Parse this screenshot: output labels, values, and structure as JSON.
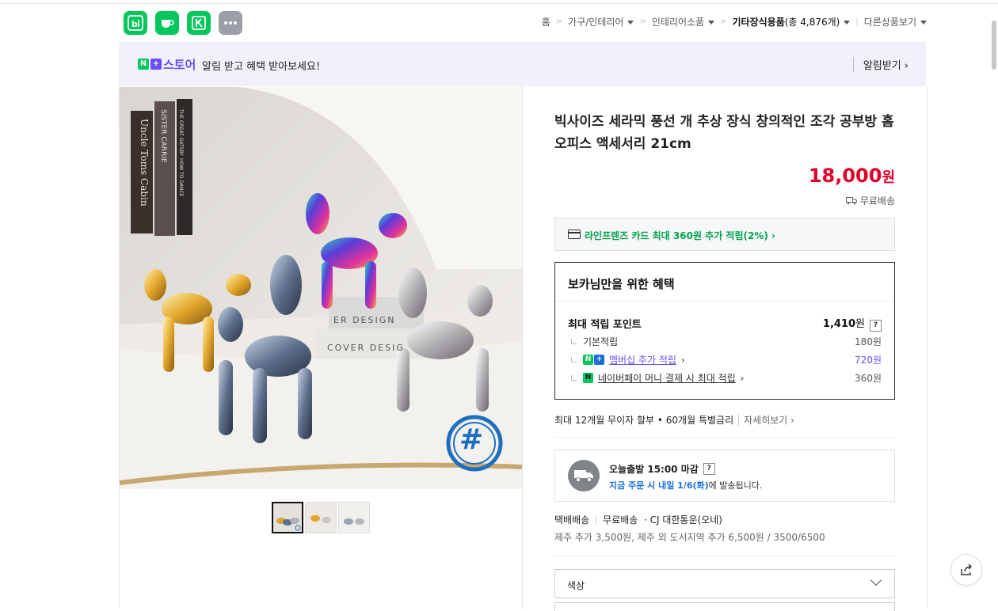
{
  "apps": [
    {
      "name": "naver-blog",
      "label": "b|"
    },
    {
      "name": "naver-cafe",
      "label": ""
    },
    {
      "name": "naver-smartstore",
      "label": ""
    },
    {
      "name": "more",
      "label": "···"
    }
  ],
  "breadcrumb": {
    "home": "홈",
    "level1": "가구/인테리어",
    "level2": "인테리어소품",
    "level3": "기타장식용품",
    "count": "(총 4,876개)",
    "other": "다른상품보기"
  },
  "banner": {
    "badge_n": "N",
    "badge_plus": "+",
    "store": "스토어",
    "message": "알림 받고 혜택 받아보세요!",
    "subscribe": "알림받기"
  },
  "product": {
    "title": "빅사이즈 세라믹 풍선 개 추상 장식 창의적인 조각 공부방 홈 오피스 액세서리 21cm",
    "price": "18,000",
    "price_unit": "원",
    "shipping": "무료배송",
    "photo_books": [
      "Uncle Toms Cabin",
      "SISTER CARRIE",
      "THE GREAT GATSBY",
      "HOW TO DANCE"
    ],
    "photo_box": [
      "ER DESIGN",
      "COVER DESIG"
    ],
    "photo_watermark": "#"
  },
  "card_benefit": "라인프렌즈 카드 최대 360원 추가 적립(2%) ›",
  "benefit": {
    "heading": "보카님만을 위한 혜택",
    "max_label": "최대 적립 포인트",
    "max_value": "1,410",
    "max_unit": "원",
    "help": "?",
    "rows": [
      {
        "label": "기본적립",
        "value": "180원"
      },
      {
        "label": "멤버십 추가 적립",
        "value": "720원"
      },
      {
        "label": "네이버페이 머니 결제 시 최대 적립",
        "value": "360원"
      }
    ]
  },
  "installment": {
    "text": "최대 12개월 무이자 할부 • 60개월 특별금리",
    "more": "자세히보기"
  },
  "delivery": {
    "title": "오늘출발 15:00 마감",
    "help": "?",
    "line_blue": "지금 주문 시 내일 1/6(화)",
    "line_rest": "에 발송됩니다."
  },
  "shipping_info": {
    "method": "택배배송",
    "fee": "무료배송",
    "carrier": "· CJ 대한통운(오네)",
    "extra": "제주 추가 3,500원, 제주 외 도서지역 추가 6,500원 / 3500/6500"
  },
  "option": {
    "label": "색상"
  },
  "colors": {
    "accent_green": "#03c75a",
    "price_red": "#e0002a",
    "store_purple": "#6a4df5",
    "link_blue": "#1a6ed8"
  }
}
